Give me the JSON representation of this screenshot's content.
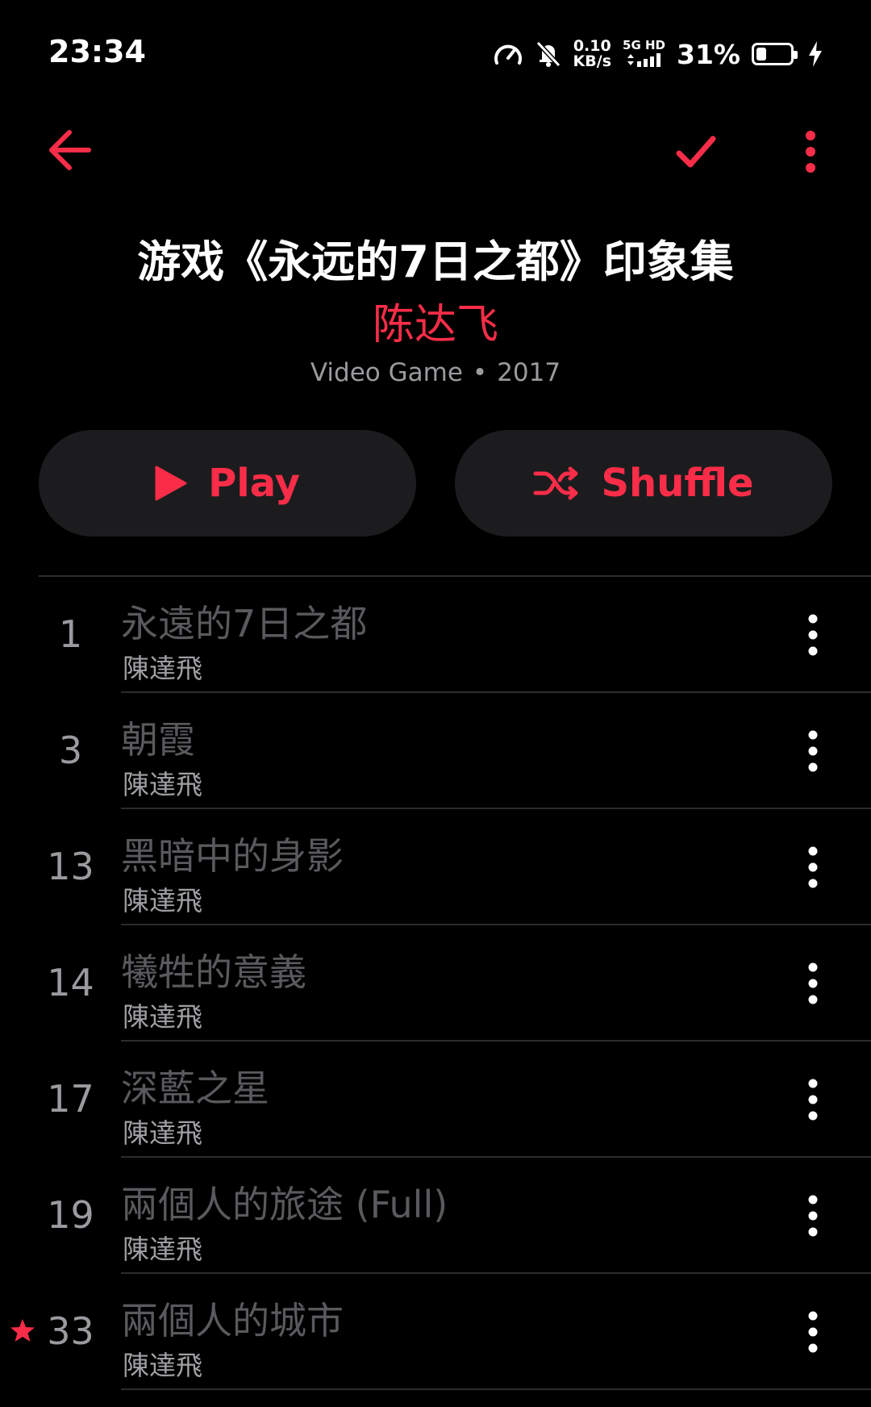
{
  "status_bar": {
    "time": "23:34",
    "net_speed_value": "0.10",
    "net_speed_unit": "KB/s",
    "net_type_top": "5G HD",
    "battery_percent": "31%",
    "battery_level": 0.31,
    "icons": [
      "speedometer-icon",
      "bell-muted-icon",
      "signal-icon",
      "battery-icon",
      "charging-bolt-icon"
    ]
  },
  "nav": {
    "icons": [
      "arrow-back-icon",
      "checkmark-icon",
      "more-vertical-icon"
    ]
  },
  "album": {
    "title": "游戏《永远的7日之都》印象集",
    "artist": "陈达飞",
    "genre": "Video Game",
    "separator": "•",
    "year": "2017"
  },
  "actions": {
    "play_label": "Play",
    "shuffle_label": "Shuffle"
  },
  "colors": {
    "accent": "#fa2d48",
    "background": "#000000",
    "button_bg": "#1c1c1e",
    "separator": "#2c2c2e"
  },
  "tracks": [
    {
      "number": "1",
      "title": "永遠的7日之都",
      "artist": "陳達飛",
      "starred": false
    },
    {
      "number": "3",
      "title": "朝霞",
      "artist": "陳達飛",
      "starred": false
    },
    {
      "number": "13",
      "title": "黑暗中的身影",
      "artist": "陳達飛",
      "starred": false
    },
    {
      "number": "14",
      "title": "犧牲的意義",
      "artist": "陳達飛",
      "starred": false
    },
    {
      "number": "17",
      "title": "深藍之星",
      "artist": "陳達飛",
      "starred": false
    },
    {
      "number": "19",
      "title": "兩個人的旅途 (Full)",
      "artist": "陳達飛",
      "starred": false
    },
    {
      "number": "33",
      "title": "兩個人的城市",
      "artist": "陳達飛",
      "starred": true
    }
  ]
}
